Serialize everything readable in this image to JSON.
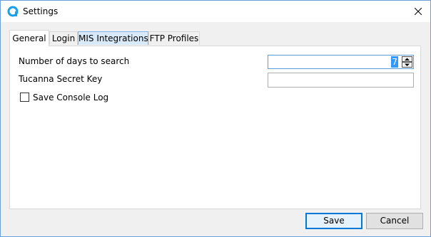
{
  "window": {
    "title": "Settings",
    "icon": "tucanna-logo-icon",
    "close_icon": "close-icon",
    "accent": "#1aa0e8"
  },
  "tabs": [
    {
      "label": "General",
      "active": true
    },
    {
      "label": "Login",
      "active": false
    },
    {
      "label": "MIS Integrations",
      "active": false
    },
    {
      "label": "FTP Profiles",
      "active": false
    }
  ],
  "general": {
    "days_label": "Number of days to search",
    "days_value": "7",
    "secret_key_label": "Tucanna Secret Key",
    "secret_key_value": "",
    "console_log_label": "Save Console Log",
    "console_log_checked": false
  },
  "buttons": {
    "save": "Save",
    "cancel": "Cancel"
  }
}
